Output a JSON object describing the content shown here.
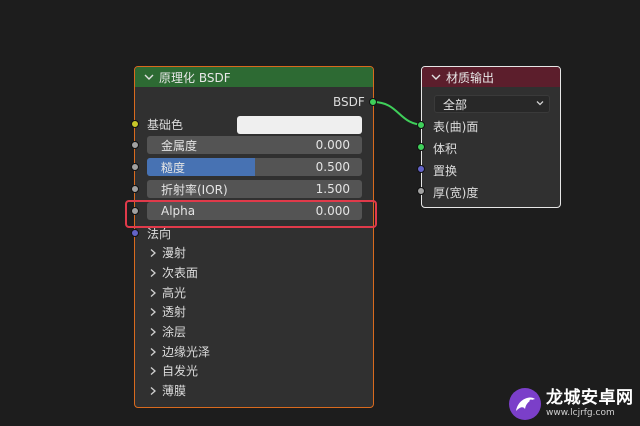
{
  "bsdf_node": {
    "title": "原理化 BSDF",
    "output_socket_label": "BSDF",
    "inputs": {
      "base_color": "基础色",
      "metallic": {
        "label": "金属度",
        "value": "0.000"
      },
      "roughness": {
        "label": "糙度",
        "value": "0.500",
        "fill": 0.5
      },
      "ior": {
        "label": "折射率(IOR)",
        "value": "1.500"
      },
      "alpha": {
        "label": "Alpha",
        "value": "0.000"
      },
      "normal": "法向"
    },
    "sections": [
      "漫射",
      "次表面",
      "高光",
      "透射",
      "涂层",
      "边缘光泽",
      "自发光",
      "薄膜"
    ]
  },
  "output_node": {
    "title": "材质输出",
    "target_dropdown": "全部",
    "inputs": [
      "表(曲)面",
      "体积",
      "置换",
      "厚(宽)度"
    ]
  },
  "watermark": {
    "title": "龙城安卓网",
    "url": "www.lcjrfg.com"
  },
  "colors": {
    "bsdf_header": "#2d6a33",
    "bsdf_border": "#d86a1e",
    "output_header": "#5c1e2c",
    "highlight": "#e03a4a",
    "slider_fill": "#4772b3",
    "socket_color": "#c7c729",
    "socket_float": "#a1a1a1",
    "socket_vector": "#6363c7",
    "socket_shader": "#3fcf5a"
  }
}
